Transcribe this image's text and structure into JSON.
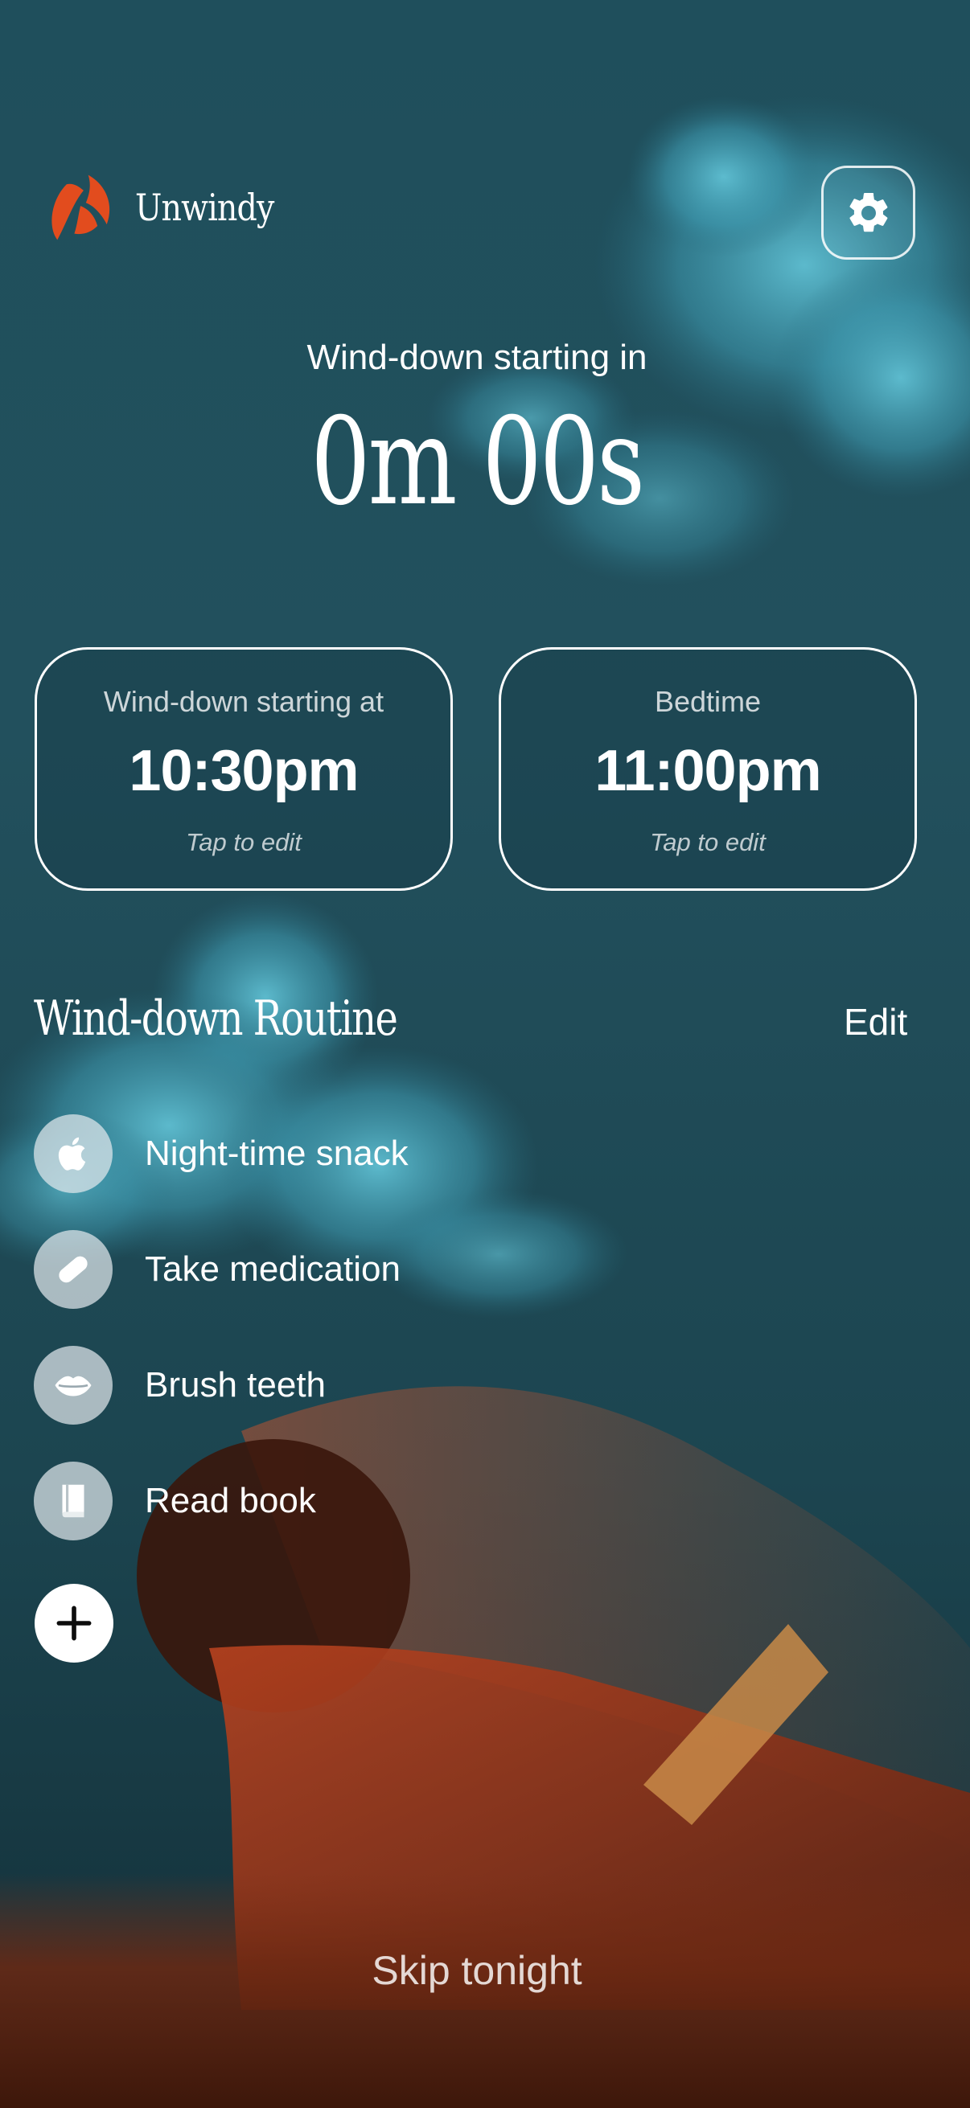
{
  "app": {
    "name": "Unwindy",
    "accent_color": "#e24c1e"
  },
  "header": {
    "logo_icon": "unwindy-logo",
    "settings_icon": "gear-icon"
  },
  "countdown": {
    "label": "Wind-down starting in",
    "value": "0m 00s"
  },
  "cards": {
    "wind_down": {
      "label": "Wind-down starting at",
      "time": "10:30pm",
      "hint": "Tap to edit"
    },
    "bedtime": {
      "label": "Bedtime",
      "time": "11:00pm",
      "hint": "Tap to edit"
    }
  },
  "routine": {
    "title": "Wind-down Routine",
    "edit_label": "Edit",
    "items": [
      {
        "label": "Night-time snack",
        "icon": "apple-icon"
      },
      {
        "label": "Take medication",
        "icon": "pill-icon"
      },
      {
        "label": "Brush teeth",
        "icon": "mouth-icon"
      },
      {
        "label": "Read book",
        "icon": "book-icon"
      }
    ],
    "add_icon": "plus-icon"
  },
  "footer": {
    "skip_label": "Skip tonight"
  }
}
